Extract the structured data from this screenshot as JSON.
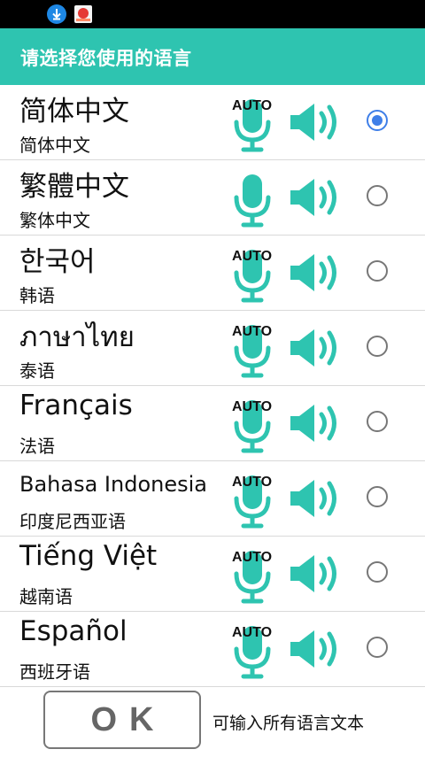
{
  "header": {
    "title": "请选择您使用的语言"
  },
  "languages": [
    {
      "name": "简体中文",
      "subtitle": "简体中文",
      "auto": "AUTO",
      "selected": true
    },
    {
      "name": "繁體中文",
      "subtitle": "繁体中文",
      "auto": "",
      "selected": false
    },
    {
      "name": "한국어",
      "subtitle": "韩语",
      "auto": "AUTO",
      "selected": false
    },
    {
      "name": "ภาษาไทย",
      "subtitle": "泰语",
      "auto": "AUTO",
      "selected": false
    },
    {
      "name": "Français",
      "subtitle": "法语",
      "auto": "AUTO",
      "selected": false
    },
    {
      "name": "Bahasa Indonesia",
      "subtitle": "印度尼西亚语",
      "auto": "AUTO",
      "selected": false
    },
    {
      "name": "Tiếng Việt",
      "subtitle": "越南语",
      "auto": "AUTO",
      "selected": false
    },
    {
      "name": "Español",
      "subtitle": "西班牙语",
      "auto": "AUTO",
      "selected": false
    }
  ],
  "footer": {
    "ok_label": "OK",
    "hint": "可输入所有语言文本"
  },
  "icons": {
    "status_download": "download-icon",
    "status_app": "app-notification-icon",
    "mic": "microphone-icon",
    "speaker": "speaker-icon"
  },
  "colors": {
    "accent": "#2ec4b0",
    "icon": "#2ec4b0",
    "radio_selected": "#3f7fe8",
    "radio_unselected": "#777777"
  }
}
